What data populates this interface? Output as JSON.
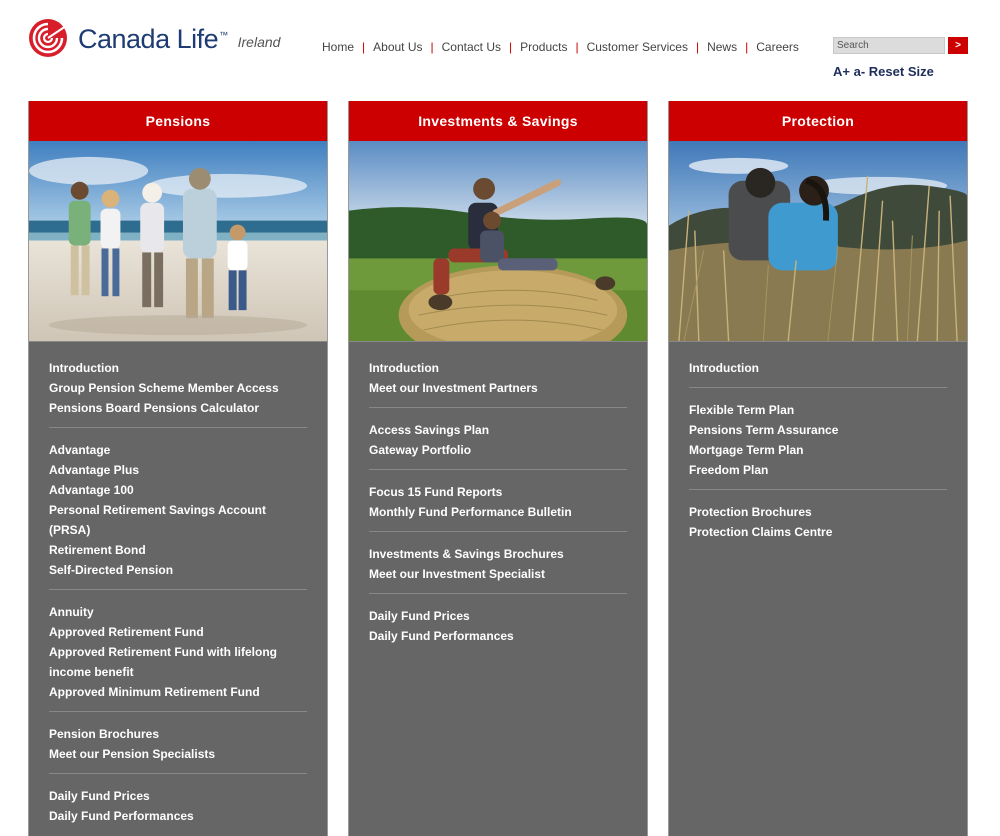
{
  "brand": {
    "name": "Canada Life",
    "trademark": "™",
    "region": "Ireland"
  },
  "topnav": [
    "Home",
    "About Us",
    "Contact Us",
    "Products",
    "Customer Services",
    "News",
    "Careers"
  ],
  "search": {
    "placeholder": "Search",
    "button": ">"
  },
  "text_size": {
    "larger": "A+",
    "smaller": "a-",
    "reset": "Reset Size"
  },
  "colors": {
    "accent": "#cc0000",
    "column_bg": "#666666",
    "brand_blue": "#1e3c73"
  },
  "columns": [
    {
      "title": "Pensions",
      "image": "family-on-beach-photo",
      "groups": [
        [
          "Introduction",
          "Group Pension Scheme Member Access",
          "Pensions Board Pensions Calculator"
        ],
        [
          "Advantage",
          "Advantage Plus",
          "Advantage 100",
          "Personal Retirement Savings Account (PRSA)",
          "Retirement Bond",
          "Self-Directed Pension"
        ],
        [
          "Annuity",
          "Approved Retirement Fund",
          "Approved Retirement Fund with lifelong income benefit",
          "Approved Minimum Retirement Fund"
        ],
        [
          "Pension Brochures",
          "Meet our Pension Specialists"
        ],
        [
          "Daily Fund Prices",
          "Daily Fund Performances"
        ]
      ]
    },
    {
      "title": "Investments & Savings",
      "image": "father-son-on-hay-bale-photo",
      "groups": [
        [
          "Introduction",
          "Meet our Investment Partners"
        ],
        [
          "Access Savings Plan",
          "Gateway Portfolio"
        ],
        [
          "Focus 15 Fund Reports",
          "Monthly Fund Performance Bulletin"
        ],
        [
          "Investments & Savings Brochures",
          "Meet our Investment Specialist"
        ],
        [
          "Daily Fund Prices",
          "Daily Fund Performances"
        ]
      ]
    },
    {
      "title": "Protection",
      "image": "couple-in-tall-grass-photo",
      "groups": [
        [
          "Introduction"
        ],
        [
          "Flexible Term Plan",
          "Pensions Term Assurance",
          "Mortgage Term Plan",
          "Freedom Plan"
        ],
        [
          "Protection Brochures",
          "Protection Claims Centre"
        ]
      ]
    }
  ]
}
